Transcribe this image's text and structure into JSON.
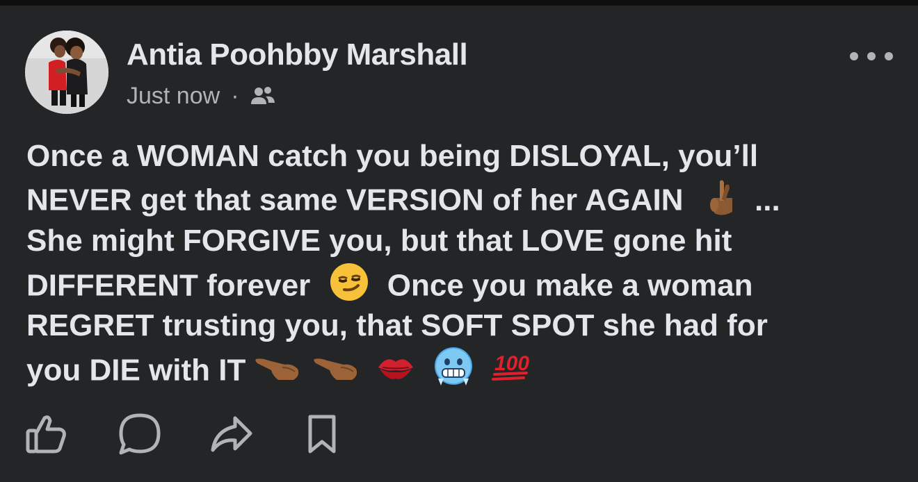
{
  "post": {
    "author": "Antia Poohbby Marshall",
    "timestamp": "Just now",
    "separator": "·",
    "audience_icon": "friends-icon",
    "more_icon": "ellipsis-icon",
    "body_lines": [
      "Once a WOMAN catch you being DISLOYAL, you’ll",
      "NEVER get that same VERSION of her AGAIN",
      "...",
      "She might FORGIVE you, but that LOVE gone hit",
      "DIFFERENT forever",
      "Once you make a woman",
      "REGRET trusting you, that SOFT SPOT she had for",
      "you DIE with IT"
    ],
    "emojis": [
      "crossed-fingers",
      "smirk",
      "pointing-hand",
      "pointing-hand",
      "kiss-mark",
      "cold-face",
      "hundred-points"
    ],
    "emoji_100_text": "100"
  },
  "actions": [
    {
      "icon": "like-icon"
    },
    {
      "icon": "comment-icon"
    },
    {
      "icon": "share-icon"
    },
    {
      "icon": "save-icon"
    }
  ],
  "colors": {
    "background": "#242526",
    "primary_text": "#e4e6eb",
    "secondary_text": "#b0b3b8"
  }
}
